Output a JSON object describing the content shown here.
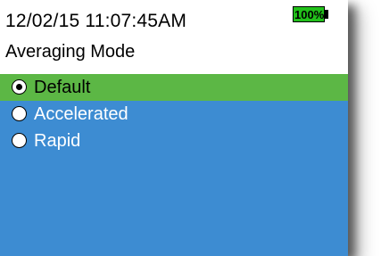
{
  "status_bar": {
    "datetime": "12/02/15  11:07:45AM",
    "battery": "100%"
  },
  "title": "Averaging Mode",
  "options": [
    {
      "label": "Default",
      "selected": true
    },
    {
      "label": "Accelerated",
      "selected": false
    },
    {
      "label": "Rapid",
      "selected": false
    }
  ],
  "colors": {
    "menu_background": "#3d8cd2",
    "selected_row": "#5cb745",
    "battery_fill": "#22c01a"
  }
}
